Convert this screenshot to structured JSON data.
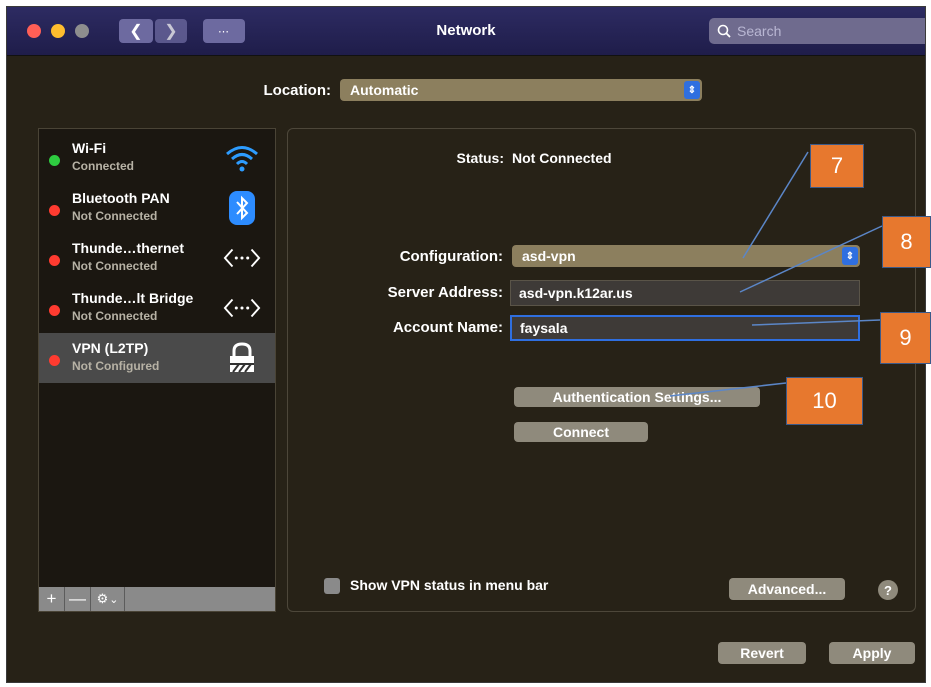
{
  "window": {
    "title": "Network"
  },
  "toolbar": {
    "back_icon": "chevron-left-icon",
    "forward_icon": "chevron-right-icon",
    "grid_icon": "grid-icon",
    "search_placeholder": "Search"
  },
  "location": {
    "label": "Location:",
    "value": "Automatic"
  },
  "services": [
    {
      "name": "Wi-Fi",
      "status": "Connected",
      "dot": "#2ecc40",
      "icon": "wifi-icon"
    },
    {
      "name": "Bluetooth PAN",
      "status": "Not Connected",
      "dot": "#ff3b30",
      "icon": "bluetooth-icon"
    },
    {
      "name": "Thunde…thernet",
      "status": "Not Connected",
      "dot": "#ff3b30",
      "icon": "ethernet-icon"
    },
    {
      "name": "Thunde…lt Bridge",
      "status": "Not Connected",
      "dot": "#ff3b30",
      "icon": "bridge-icon"
    },
    {
      "name": "VPN (L2TP)",
      "status": "Not Configured",
      "dot": "#ff3b30",
      "icon": "vpn-lock-icon",
      "selected": true
    }
  ],
  "sidebar_actions": {
    "add": "+",
    "remove": "—",
    "gear": "⚙",
    "gear_caret": "⌄"
  },
  "detail": {
    "status_label": "Status:",
    "status_value": "Not Connected",
    "configuration_label": "Configuration:",
    "configuration_value": "asd-vpn",
    "server_label": "Server Address:",
    "server_value": "asd-vpn.k12ar.us",
    "account_label": "Account Name:",
    "account_value": "faysala",
    "auth_button": "Authentication Settings...",
    "connect_button": "Connect",
    "show_status_label": "Show VPN status in menu bar",
    "advanced_button": "Advanced...",
    "help": "?"
  },
  "footer": {
    "revert": "Revert",
    "apply": "Apply"
  },
  "callouts": [
    "7",
    "8",
    "9",
    "10"
  ],
  "colors": {
    "accent": "#2f6fe0",
    "callout": "#e7782e",
    "titlebar": "#2d2b62"
  }
}
